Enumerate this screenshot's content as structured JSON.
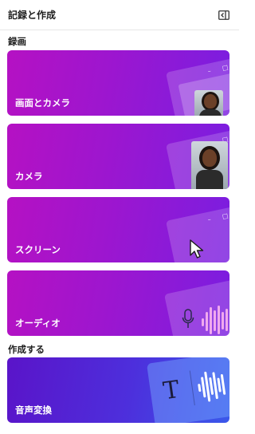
{
  "header": {
    "title": "記録と作成",
    "collapse_icon": "panel-collapse-icon"
  },
  "sections": {
    "record": "録画",
    "create": "作成する"
  },
  "cards": {
    "screen_camera": "画面とカメラ",
    "camera": "カメラ",
    "screen": "スクリーン",
    "audio": "オーディオ",
    "transcribe": "音声変換"
  },
  "colors": {
    "card_purple": "#a314c9",
    "card_blue": "#4d2fdc",
    "wave_pink": "#f0a9ee"
  }
}
